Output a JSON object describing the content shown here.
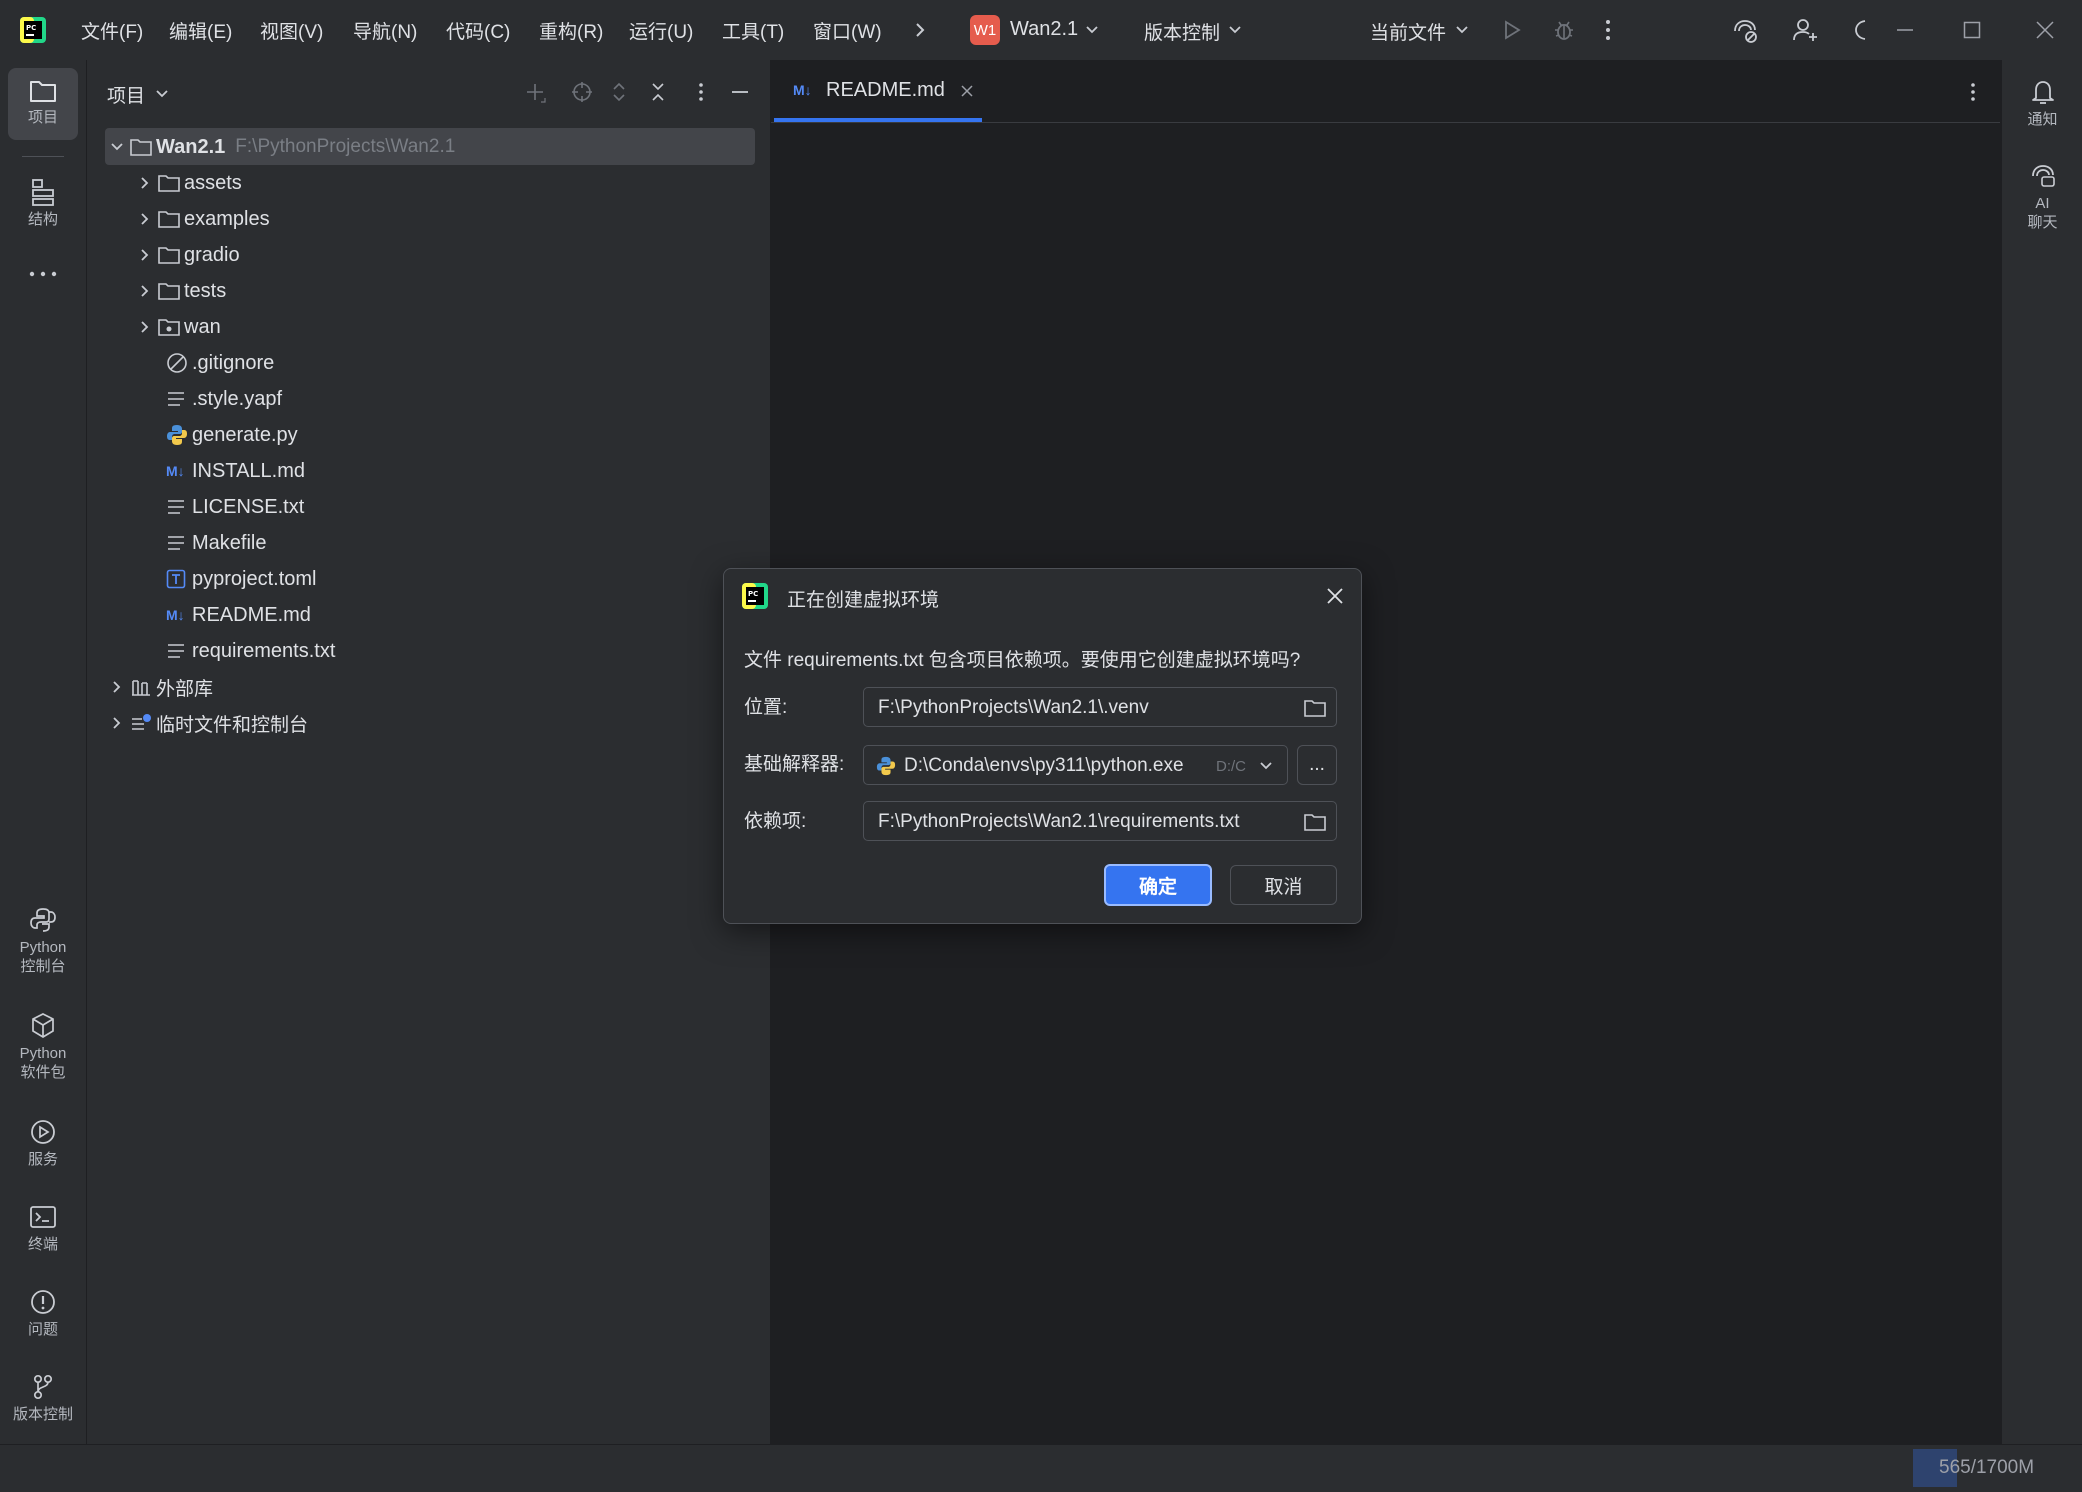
{
  "menu": [
    "文件(F)",
    "编辑(E)",
    "视图(V)",
    "导航(N)",
    "代码(C)",
    "重构(R)",
    "运行(U)",
    "工具(T)",
    "窗口(W)"
  ],
  "project": {
    "badge": "W1",
    "name": "Wan2.1"
  },
  "vcs_label": "版本控制",
  "run_config": "当前文件",
  "left_tools": {
    "project": "项目",
    "structure": "结构",
    "python_console": [
      "Python",
      "控制台"
    ],
    "python_packages": [
      "Python",
      "软件包"
    ],
    "services": "服务",
    "terminal": "终端",
    "problems": "问题",
    "vcs": "版本控制"
  },
  "panel_title": "项目",
  "tree": {
    "root": {
      "name": "Wan2.1",
      "path": "F:\\PythonProjects\\Wan2.1"
    },
    "items": [
      {
        "name": "assets",
        "type": "folder"
      },
      {
        "name": "examples",
        "type": "folder"
      },
      {
        "name": "gradio",
        "type": "folder"
      },
      {
        "name": "tests",
        "type": "folder"
      },
      {
        "name": "wan",
        "type": "package"
      },
      {
        "name": ".gitignore",
        "type": "ignore"
      },
      {
        "name": ".style.yapf",
        "type": "text"
      },
      {
        "name": "generate.py",
        "type": "python"
      },
      {
        "name": "INSTALL.md",
        "type": "markdown"
      },
      {
        "name": "LICENSE.txt",
        "type": "text"
      },
      {
        "name": "Makefile",
        "type": "text"
      },
      {
        "name": "pyproject.toml",
        "type": "toml"
      },
      {
        "name": "README.md",
        "type": "markdown"
      },
      {
        "name": "requirements.txt",
        "type": "text"
      }
    ],
    "external_libs": "外部库",
    "scratches": "临时文件和控制台"
  },
  "editor_tab": {
    "icon_text": "M↓",
    "label": "README.md"
  },
  "right_tools": {
    "notifications": "通知",
    "ai_chat": [
      "AI",
      "聊天"
    ]
  },
  "dialog": {
    "title": "正在创建虚拟环境",
    "message": "文件 requirements.txt 包含项目依赖项。要使用它创建虚拟环境吗?",
    "location_label": "位置:",
    "location_value": "F:\\PythonProjects\\Wan2.1\\.venv",
    "interpreter_label": "基础解释器:",
    "interpreter_value": "D:\\Conda\\envs\\py311\\python.exe",
    "interpreter_hint": "D:/C",
    "browse_label": "...",
    "deps_label": "依赖项:",
    "deps_value": "F:\\PythonProjects\\Wan2.1\\requirements.txt",
    "ok_label": "确定",
    "cancel_label": "取消"
  },
  "status": {
    "memory": "565/1700M",
    "memory_fraction": 0.33
  },
  "colors": {
    "accent": "#3574f0",
    "python_yellow": "#f2c94c",
    "markdown_blue": "#548af7",
    "project_badge": "#e55c4d"
  }
}
